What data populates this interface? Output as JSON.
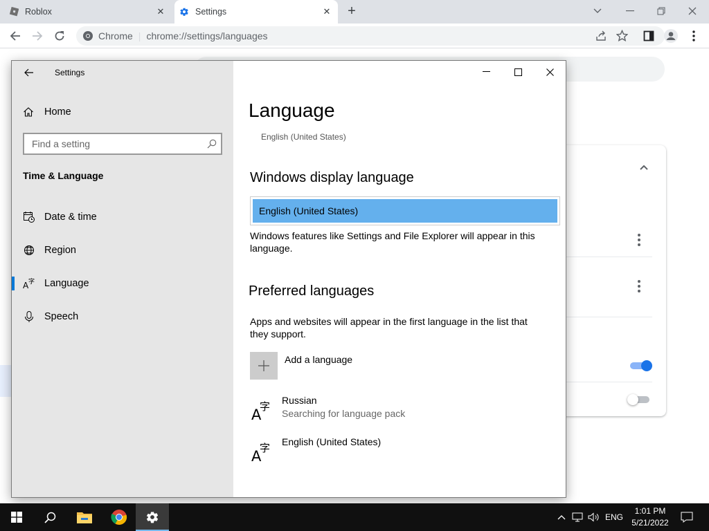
{
  "browser": {
    "tabs": [
      {
        "title": "Roblox",
        "active": false
      },
      {
        "title": "Settings",
        "active": true
      }
    ],
    "site_label": "Chrome",
    "url": "chrome://settings/languages"
  },
  "settings_window": {
    "title": "Settings",
    "nav": {
      "home": "Home",
      "search_placeholder": "Find a setting",
      "section": "Time & Language",
      "items": [
        {
          "label": "Date & time",
          "icon": "calendar-clock-icon",
          "active": false
        },
        {
          "label": "Region",
          "icon": "globe-icon",
          "active": false
        },
        {
          "label": "Language",
          "icon": "language-icon",
          "active": true
        },
        {
          "label": "Speech",
          "icon": "microphone-icon",
          "active": false
        }
      ]
    },
    "content": {
      "title": "Language",
      "current_language": "English (United States)",
      "display_language": {
        "heading": "Windows display language",
        "selected": "English (United States)",
        "description": "Windows features like Settings and File Explorer will appear in this language."
      },
      "preferred": {
        "heading": "Preferred languages",
        "description": "Apps and websites will appear in the first language in the list that they support.",
        "add_label": "Add a language",
        "languages": [
          {
            "name": "Russian",
            "status": "Searching for language pack"
          },
          {
            "name": "English (United States)",
            "status": ""
          }
        ]
      }
    }
  },
  "taskbar": {
    "input_language": "ENG",
    "time": "1:01 PM",
    "date": "5/21/2022"
  },
  "colors": {
    "accent": "#0078d7",
    "selection": "#64b0ed",
    "chrome_toggle": "#1a73e8"
  }
}
